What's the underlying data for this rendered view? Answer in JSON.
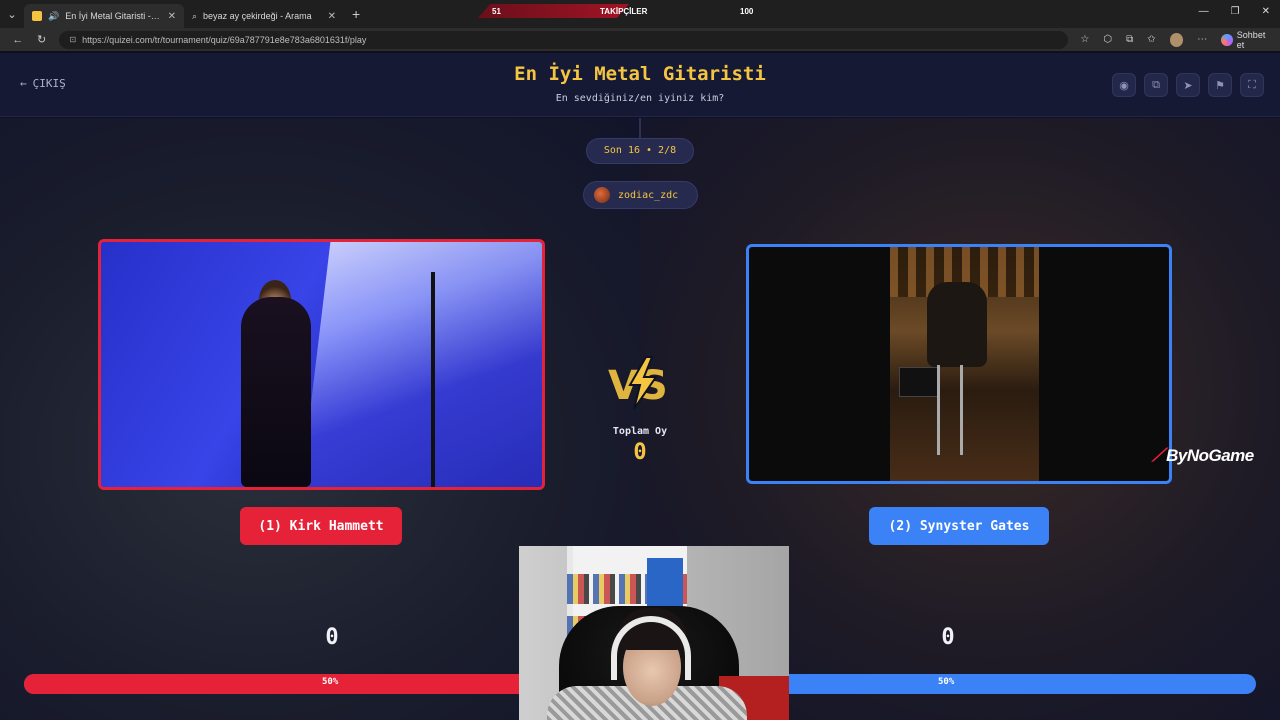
{
  "browser": {
    "tabs": [
      {
        "title": "En İyi Metal Gitaristi - Tier Lis",
        "active": true
      },
      {
        "title": "beyaz ay çekirdeği - Arama",
        "active": false
      }
    ],
    "new_tab": "+",
    "url": "https://quizei.com/tr/tournament/quiz/69a787791e8e783a6801631f/play",
    "copilot_label": "Sohbet et"
  },
  "follow_goal": {
    "current": "51",
    "label": "TAKİPÇİLER",
    "target": "100",
    "progress": 0.51
  },
  "header": {
    "exit_label": "ÇIKIŞ",
    "title": "En İyi Metal Gitaristi",
    "subtitle": "En sevdiğiniz/en iyiniz kim?",
    "actions": [
      "eye-icon",
      "share-icon",
      "send-icon",
      "flag-icon",
      "fullscreen-icon"
    ]
  },
  "round": {
    "label": "Son 16 • 2/8",
    "player": "zodiac_zdc"
  },
  "versus": {
    "total_label": "Toplam Oy",
    "total_value": "0"
  },
  "choices": {
    "left": {
      "label": "(1) Kirk Hammett",
      "votes": "0",
      "percent_text": "50%",
      "share": 0.5,
      "color": "#e52238"
    },
    "right": {
      "label": "(2) Synyster Gates",
      "votes": "0",
      "percent_text": "50%",
      "share": 0.5,
      "color": "#3a82f6"
    }
  },
  "watermark": "ByNoGame",
  "colors": {
    "accent": "#f5c542",
    "left": "#e52238",
    "right": "#3a82f6",
    "background": "#0f1122"
  }
}
